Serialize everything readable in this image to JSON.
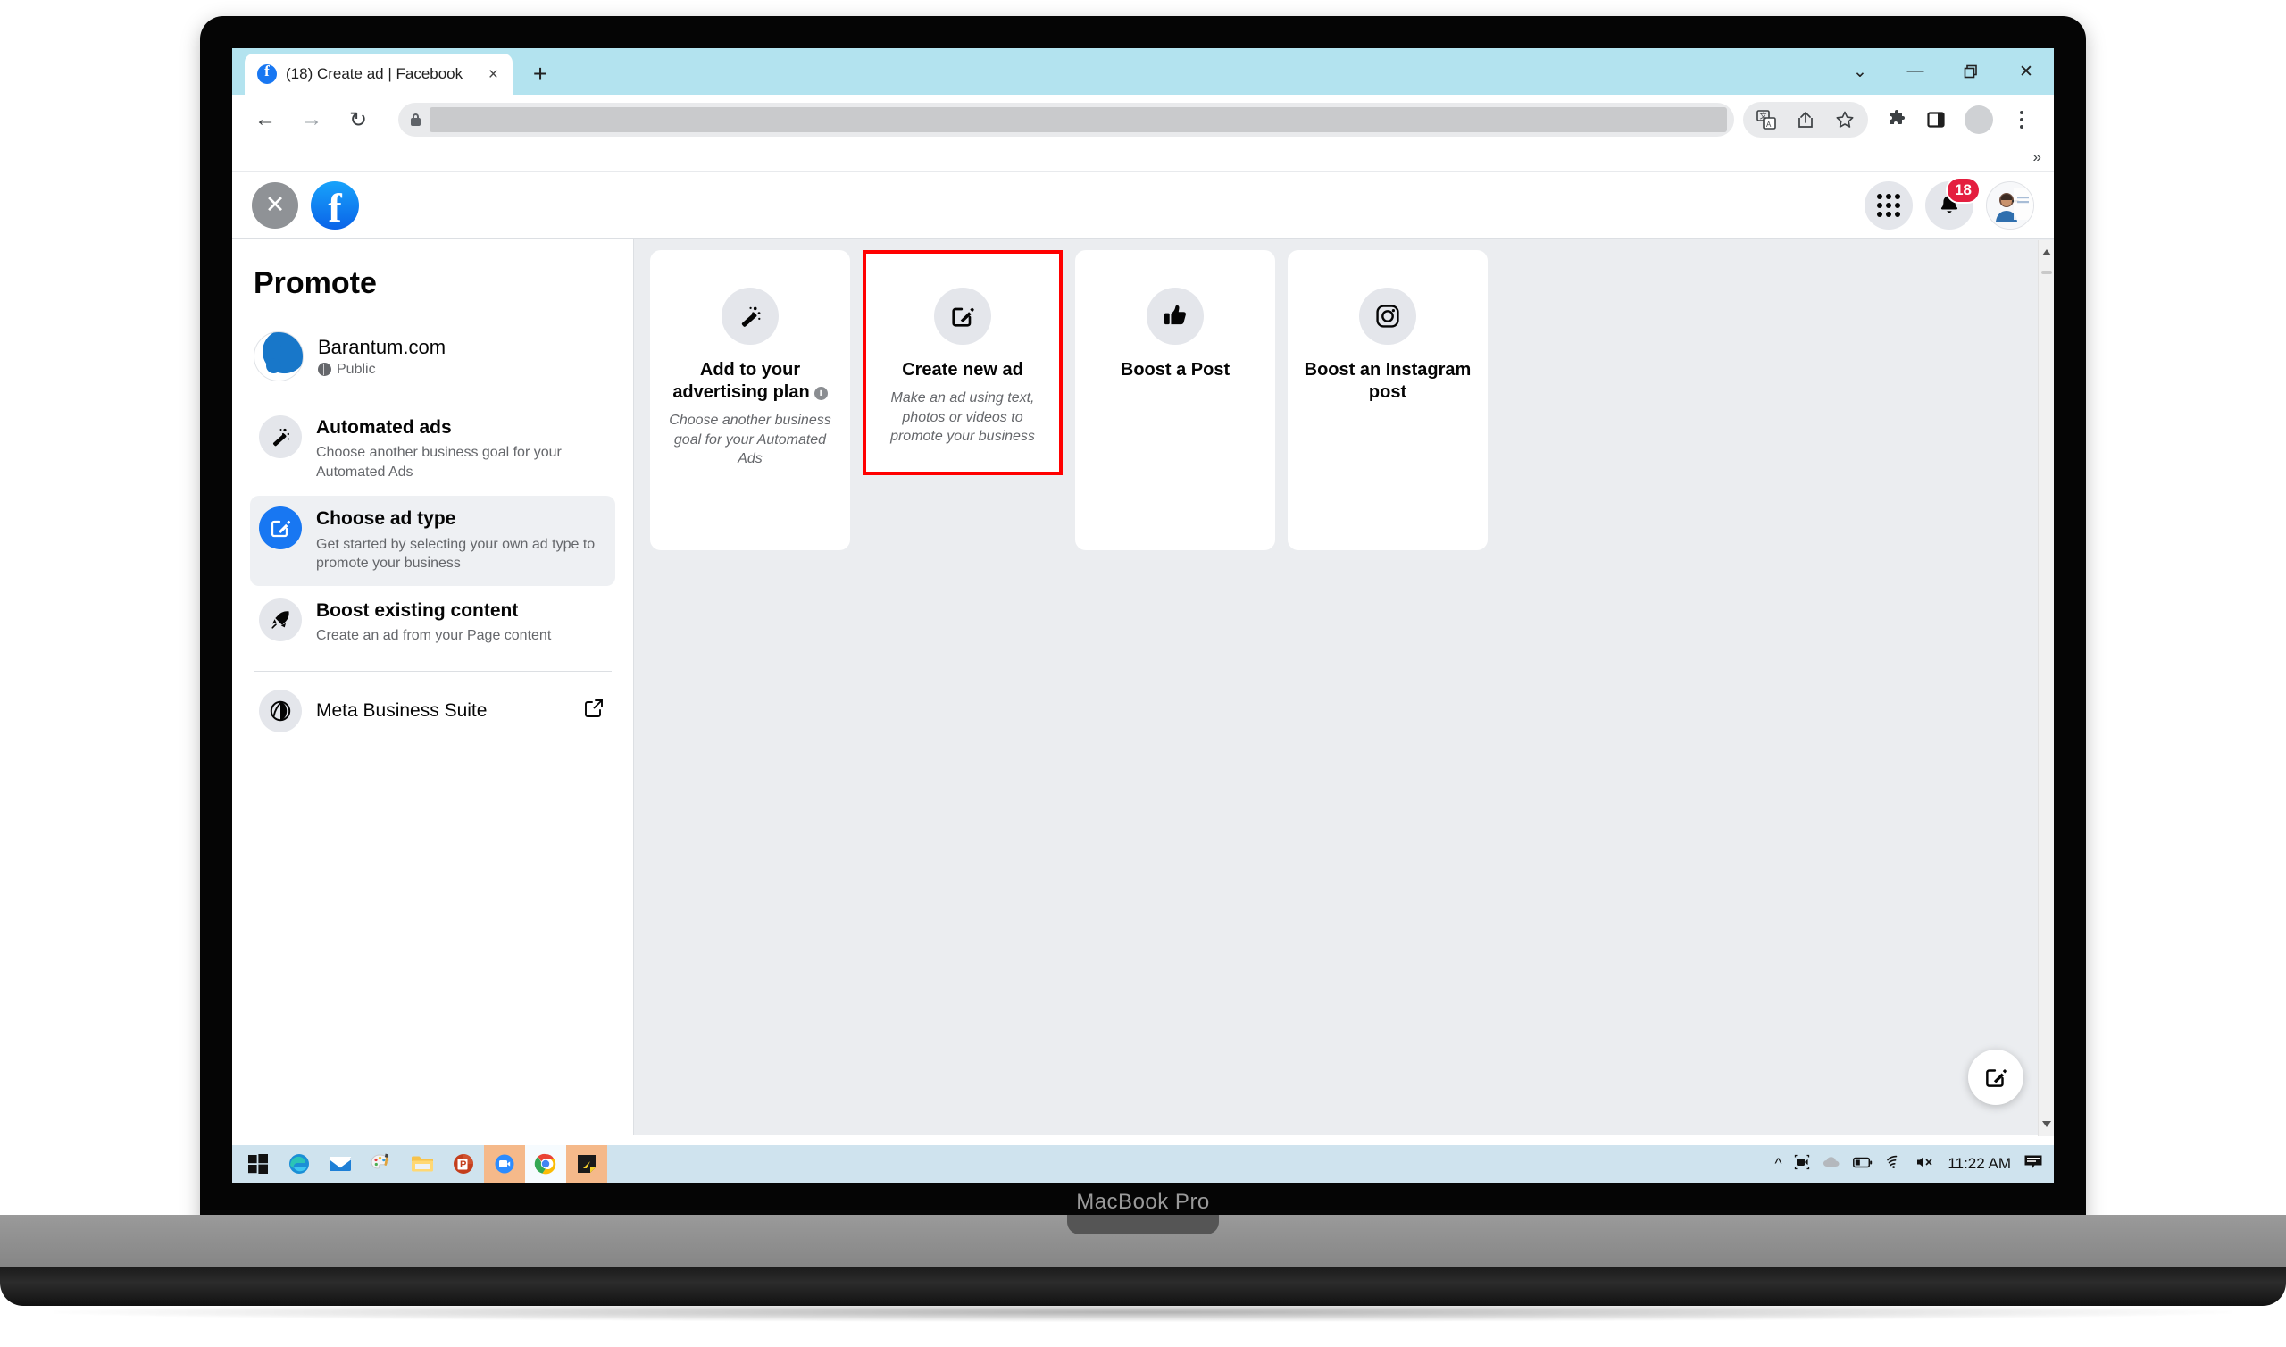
{
  "device": {
    "label": "MacBook Pro"
  },
  "browser": {
    "tab": {
      "title": "(18) Create ad | Facebook",
      "favicon": "facebook-icon",
      "close": "×"
    },
    "new_tab_label": "+",
    "window_controls": {
      "minimize_to_tray": "⌄",
      "minimize": "—",
      "restore": "❐",
      "close": "✕"
    },
    "nav": {
      "back": "←",
      "forward": "→",
      "reload": "↻"
    },
    "omnibox": {
      "value": "",
      "placeholder": "",
      "lock_icon": "lock-icon"
    },
    "toolbar_icons": [
      "translate-icon",
      "share-icon",
      "star-icon",
      "extensions-icon",
      "side-panel-icon",
      "profile-avatar-icon",
      "chrome-menu-icon"
    ],
    "bookmarks_overflow": "»"
  },
  "fb_header": {
    "close_label": "✕",
    "logo": "facebook-logo",
    "menu_icon": "app-grid-icon",
    "notifications_icon": "bell-icon",
    "notifications_count": "18",
    "profile": "profile-avatar"
  },
  "sidebar": {
    "title": "Promote",
    "page": {
      "name": "Barantum.com",
      "privacy": "Public",
      "privacy_icon": "globe-icon"
    },
    "items": [
      {
        "icon": "magic-wand-icon",
        "title": "Automated ads",
        "desc": "Choose another business goal for your Automated Ads",
        "active": false
      },
      {
        "icon": "pencil-square-icon",
        "title": "Choose ad type",
        "desc": "Get started by selecting your own ad type to promote your business",
        "active": true
      },
      {
        "icon": "rocket-icon",
        "title": "Boost existing content",
        "desc": "Create an ad from your Page content",
        "active": false
      }
    ],
    "meta_business_suite": {
      "title": "Meta Business Suite",
      "icon": "meta-icon",
      "external_icon": "external-link-icon"
    }
  },
  "main": {
    "cards": [
      {
        "icon": "magic-wand-icon",
        "title": "Add to your advertising plan",
        "has_info": true,
        "info_glyph": "i",
        "desc": "Choose another business goal for your Automated Ads",
        "highlighted": false
      },
      {
        "icon": "pencil-square-icon",
        "title": "Create new ad",
        "has_info": false,
        "desc": "Make an ad using text, photos or videos to promote your business",
        "highlighted": true
      },
      {
        "icon": "thumbs-up-icon",
        "title": "Boost a Post",
        "has_info": false,
        "desc": "",
        "highlighted": false
      },
      {
        "icon": "instagram-icon",
        "title": "Boost an Instagram post",
        "has_info": false,
        "desc": "",
        "highlighted": false
      }
    ],
    "fab_icon": "compose-icon"
  },
  "taskbar": {
    "apps": [
      "windows-start-icon",
      "edge-icon",
      "mail-icon",
      "paint-icon",
      "file-explorer-icon",
      "powerpoint-icon",
      "zoom-icon",
      "chrome-icon",
      "sticky-notes-icon"
    ],
    "tray": [
      "show-hidden-icons-chevron",
      "camera-icon",
      "onedrive-icon",
      "battery-icon",
      "wifi-icon",
      "volume-muted-icon"
    ],
    "clock": "11:22 AM",
    "action_center_icon": "notifications-icon"
  },
  "colors": {
    "accent": "#1877f2",
    "highlight": "#ff0000",
    "badge": "#e41e3f",
    "tabstrip": "#b3e3ef",
    "content_bg": "#ebedf0"
  }
}
